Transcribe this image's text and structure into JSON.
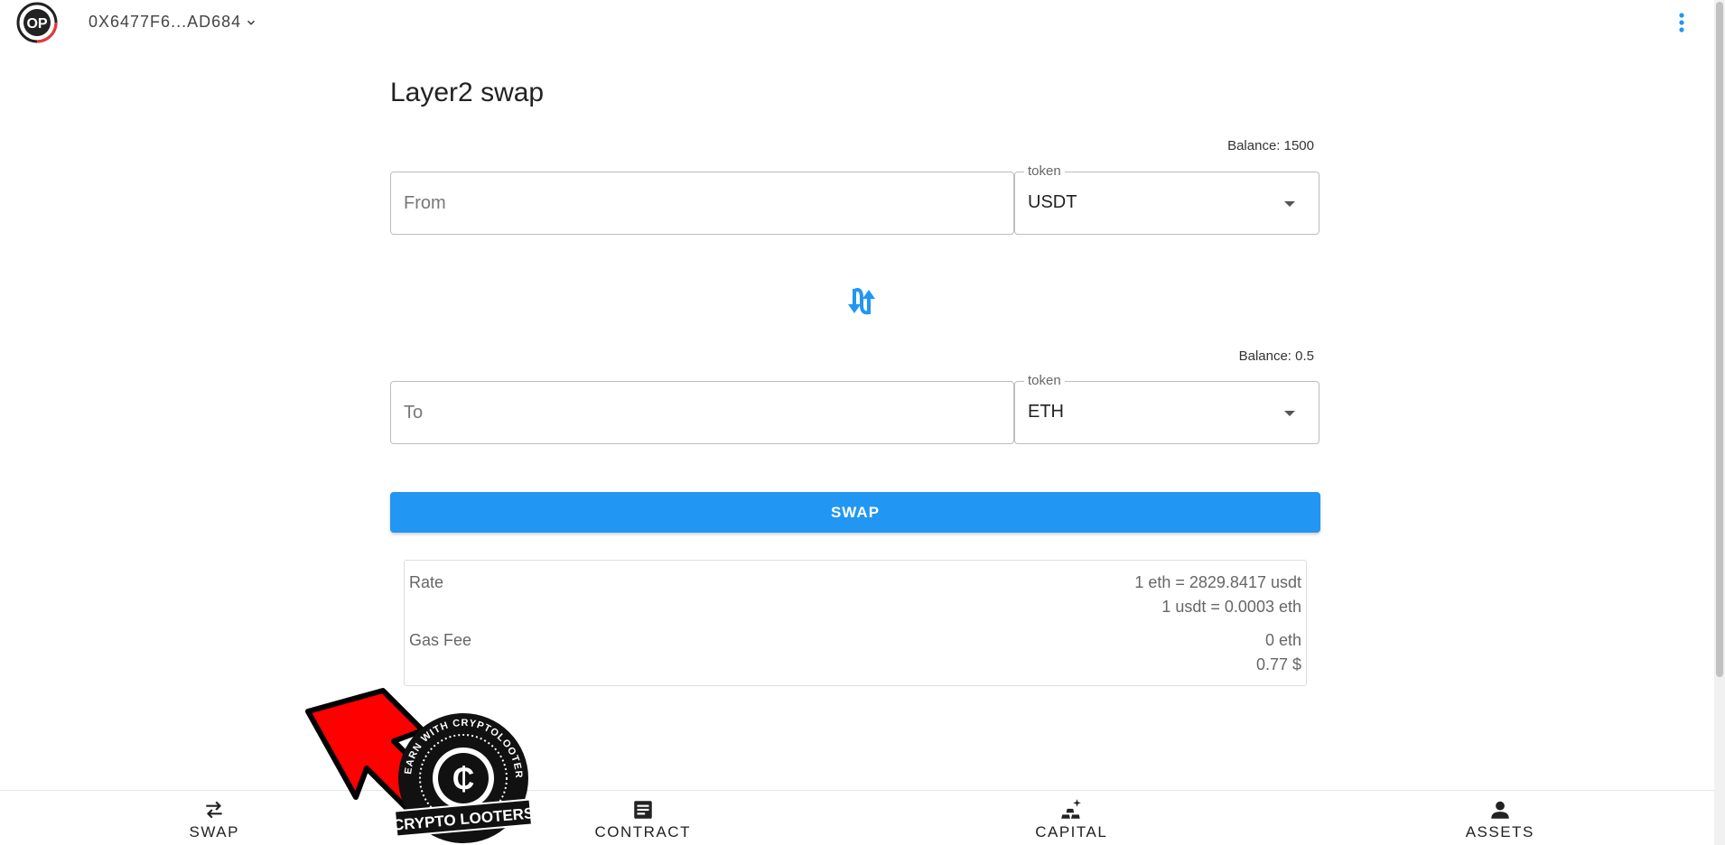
{
  "header": {
    "wallet_address": "0X6477F6...AD684"
  },
  "page": {
    "title": "Layer2 swap"
  },
  "from": {
    "balance": "Balance: 1500",
    "placeholder": "From",
    "token_legend": "token",
    "token_value": "USDT"
  },
  "to": {
    "balance": "Balance: 0.5",
    "placeholder": "To",
    "token_legend": "token",
    "token_value": "ETH"
  },
  "swap_button_label": "SWAP",
  "info": {
    "rate_label": "Rate",
    "rate_line1": "1 eth = 2829.8417 usdt",
    "rate_line2": "1 usdt = 0.0003 eth",
    "gas_label": "Gas Fee",
    "gas_line1": "0 eth",
    "gas_line2": "0.77 $"
  },
  "bottom_nav": {
    "swap": "SWAP",
    "contract": "CONTRACT",
    "capital": "CAPITAL",
    "assets": "ASSETS"
  },
  "watermark": {
    "ring_text": "EARN WITH CRYPTOLOOTERS",
    "banner": "CRYPTO LOOTERS"
  },
  "colors": {
    "accent": "#2196f3",
    "arrow_overlay": "#ff0000"
  }
}
